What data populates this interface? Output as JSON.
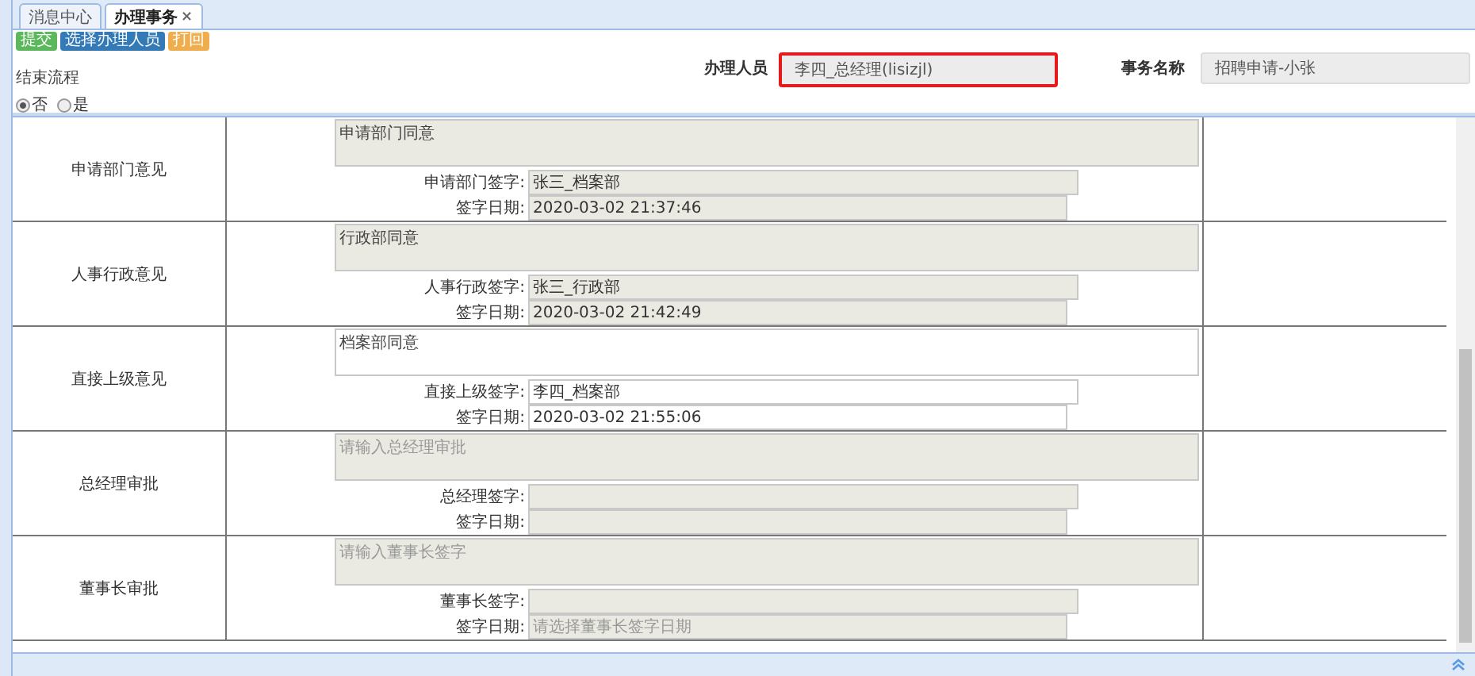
{
  "tabs": [
    {
      "label": "消息中心",
      "selected": false
    },
    {
      "label": "办理事务",
      "selected": true,
      "close": "×"
    }
  ],
  "toolbar": [
    {
      "label": "提交",
      "kind": "success"
    },
    {
      "label": "选择办理人员",
      "kind": "primary"
    },
    {
      "label": "打回",
      "kind": "warning"
    }
  ],
  "end_flow": {
    "label": "结束流程",
    "options": [
      {
        "label": "否",
        "selected": true
      },
      {
        "label": "是",
        "selected": false
      }
    ]
  },
  "handler": {
    "label": "办理人员",
    "value": "李四_总经理(lisizjl)",
    "invalid": true
  },
  "task_name": {
    "label": "事务名称",
    "value": "招聘申请-小张"
  },
  "sections": [
    {
      "title": "申请部门意见",
      "disabled": true,
      "opinion": {
        "value": "申请部门同意"
      },
      "sign": {
        "label": "申请部门签字:",
        "value": "张三_档案部"
      },
      "date": {
        "label": "签字日期:",
        "value": "2020-03-02 21:37:46"
      }
    },
    {
      "title": "人事行政意见",
      "disabled": true,
      "opinion": {
        "value": "行政部同意"
      },
      "sign": {
        "label": "人事行政签字:",
        "value": "张三_行政部"
      },
      "date": {
        "label": "签字日期:",
        "value": "2020-03-02 21:42:49"
      }
    },
    {
      "title": "直接上级意见",
      "disabled": false,
      "opinion": {
        "value": "档案部同意"
      },
      "sign": {
        "label": "直接上级签字:",
        "value": "李四_档案部"
      },
      "date": {
        "label": "签字日期:",
        "value": "2020-03-02 21:55:06"
      }
    },
    {
      "title": "总经理审批",
      "disabled": true,
      "opinion": {
        "placeholder": "请输入总经理审批"
      },
      "sign": {
        "label": "总经理签字:"
      },
      "date": {
        "label": "签字日期:"
      }
    },
    {
      "title": "董事长审批",
      "disabled": true,
      "opinion": {
        "placeholder": "请输入董事长签字"
      },
      "sign": {
        "label": "董事长签字:"
      },
      "date": {
        "label": "签字日期:",
        "placeholder": "请选择董事长签字日期"
      }
    }
  ]
}
